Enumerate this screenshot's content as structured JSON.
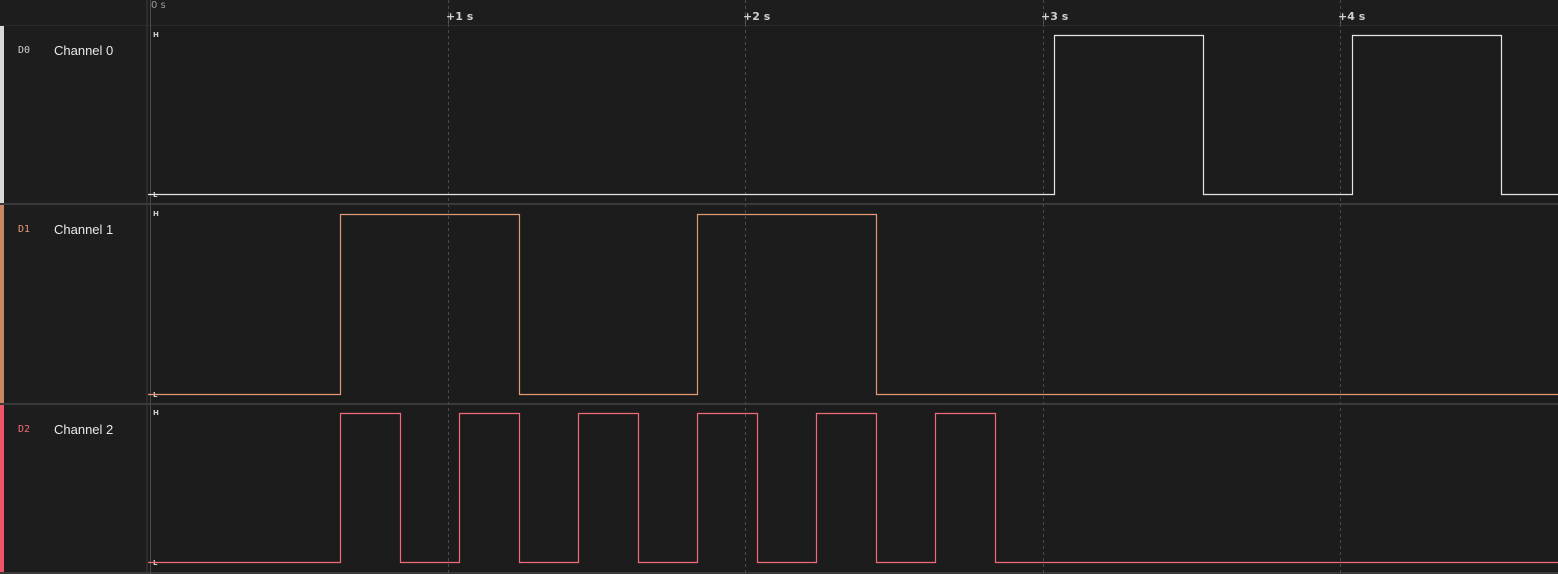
{
  "ruler": {
    "origin": "0 s",
    "ticks": [
      "+1 s",
      "+2 s",
      "+3 s",
      "+4 s"
    ]
  },
  "level_labels": {
    "high": "H",
    "low": "L"
  },
  "colors": {
    "background": "#1c1c1c",
    "grid": "#4a4a4a"
  },
  "time_span_s": 4.73,
  "channels": [
    {
      "id": "D0",
      "name": "Channel 0",
      "color": "#e6e6e6",
      "edges_s": [
        0,
        3.04,
        3.54,
        4.04,
        4.54
      ],
      "initial": 0
    },
    {
      "id": "D1",
      "name": "Channel 1",
      "color": "#e39a74",
      "edges_s": [
        0,
        0.64,
        1.24,
        1.84,
        2.44
      ],
      "initial": 0
    },
    {
      "id": "D2",
      "name": "Channel 2",
      "color": "#f06a78",
      "edges_s": [
        0,
        0.64,
        0.84,
        1.04,
        1.24,
        1.44,
        1.64,
        1.84,
        2.04,
        2.24,
        2.44,
        2.64,
        2.84
      ],
      "initial": 0
    }
  ]
}
